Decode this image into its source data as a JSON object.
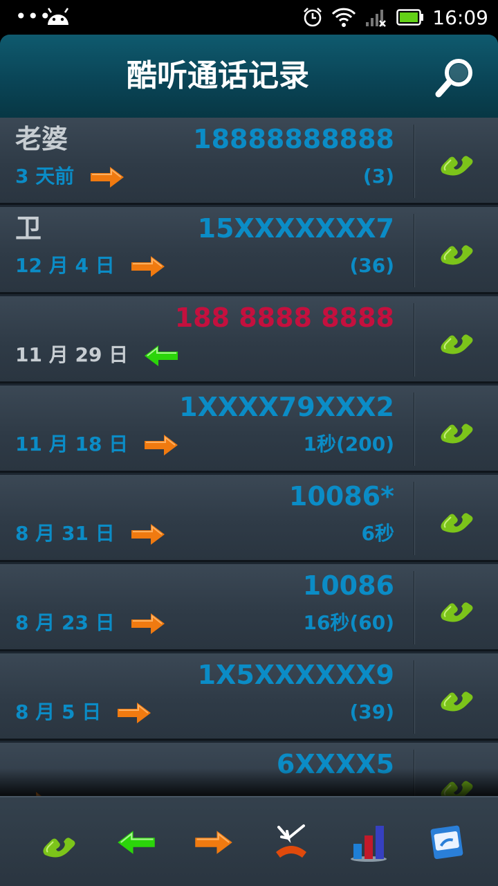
{
  "status_bar": {
    "dots": "•••",
    "time": "16:09",
    "icons": [
      "android-icon",
      "alarm-icon",
      "wifi-icon",
      "signal-icon",
      "battery-icon"
    ]
  },
  "header": {
    "title": "酷听通话记录",
    "search_icon": "search-icon"
  },
  "colors": {
    "header_bg": "#0a4557",
    "number_blue": "#0b8cc6",
    "missed_red": "#c4103e",
    "outgoing_orange": "#f07a10",
    "incoming_green": "#2bd40a",
    "call_green": "#7cc41a"
  },
  "calls": [
    {
      "name": "老婆",
      "number": "18888888888",
      "date": "3 天前",
      "direction": "outgoing",
      "meta": "(3)"
    },
    {
      "name": "卫",
      "number": "15XXXXXXX7",
      "date": "12 月 4 日",
      "direction": "outgoing",
      "meta": "(36)"
    },
    {
      "name": "",
      "number": "188 8888 8888",
      "date": "11 月 29 日",
      "direction": "incoming",
      "meta": ""
    },
    {
      "name": "",
      "number": "1XXXX79XXX2",
      "date": "11 月 18 日",
      "direction": "outgoing",
      "meta": "1秒(200)"
    },
    {
      "name": "",
      "number": "10086*",
      "date": "8 月 31 日",
      "direction": "outgoing",
      "meta": "6秒"
    },
    {
      "name": "",
      "number": "10086",
      "date": "8 月 23 日",
      "direction": "outgoing",
      "meta": "16秒(60)"
    },
    {
      "name": "",
      "number": "1X5XXXXXX9",
      "date": "8 月 5 日",
      "direction": "outgoing",
      "meta": "(39)"
    },
    {
      "name": "",
      "number": "6XXXX5",
      "date": "",
      "direction": "outgoing",
      "meta": ""
    }
  ],
  "toolbar": {
    "buttons": [
      "all-calls-icon",
      "incoming-calls-icon",
      "outgoing-calls-icon",
      "missed-calls-icon",
      "statistics-icon",
      "app-logo-icon"
    ]
  }
}
